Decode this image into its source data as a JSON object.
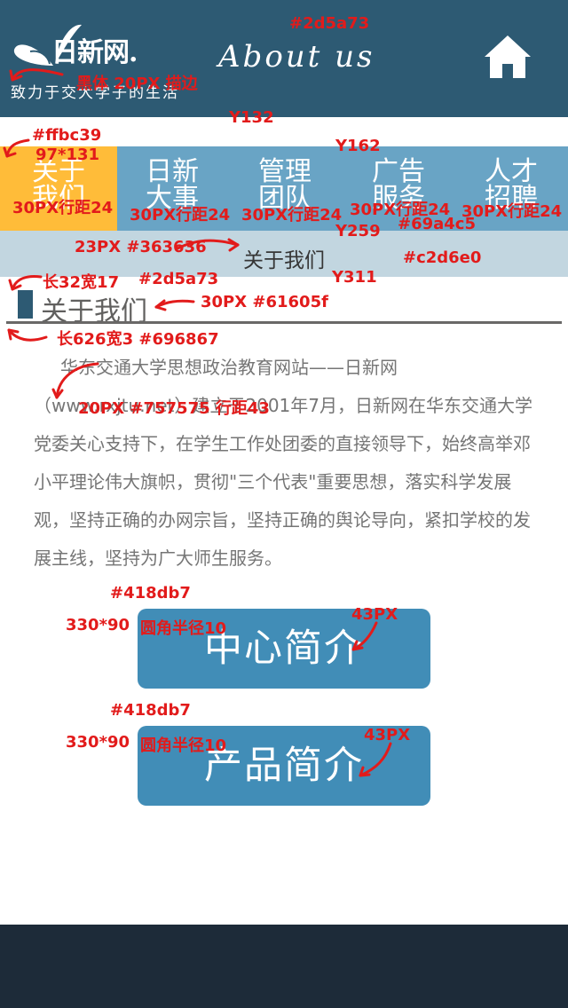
{
  "header": {
    "logo_text": "日新网.",
    "slogan": "致力于交大学子的生活",
    "page_title": "About us",
    "bg_color": "#2d5a73"
  },
  "nav": {
    "items": [
      {
        "label": "关于我们",
        "active": true
      },
      {
        "label": "日新大事",
        "active": false
      },
      {
        "label": "管理团队",
        "active": false
      },
      {
        "label": "广告服务",
        "active": false
      },
      {
        "label": "人才招聘",
        "active": false
      }
    ],
    "bg_color": "#69a4c5",
    "active_color": "#ffbc39"
  },
  "subbar": {
    "label": "关于我们",
    "bg_color": "#c2d6e0"
  },
  "section": {
    "title": "关于我们"
  },
  "content": {
    "text": "华东交通大学思想政治教育网站——日新网（www.rxjtu.net）建立于2001年7月，日新网在华东交通大学党委关心支持下，在学生工作处团委的直接领导下，始终高举邓小平理论伟大旗帜，贯彻\"三个代表\"重要思想，落实科学发展观，坚持正确的办网宗旨，坚持正确的舆论导向，紧扣学校的发展主线，坚持为广大师生服务。"
  },
  "buttons": {
    "center_intro": "中心简介",
    "product_intro": "产品简介",
    "color": "#418db7"
  },
  "annotations": {
    "header_color": "#2d5a73",
    "slogan_spec": "黑体 20PX 描边",
    "y132": "Y132",
    "nav_active_color": "#ffbc39",
    "nav_active_size": "97*131",
    "y162": "Y162",
    "nav_font_1": "30PX行距24",
    "nav_font_2": "30PX行距24",
    "nav_font_3": "30PX行距24",
    "nav_font_4": "30PX行距24",
    "nav_font_5": "30PX行距24",
    "y259": "Y259",
    "nav_color": "#69a4c5",
    "subbar_font": "23PX #363636",
    "subbar_color": "#c2d6e0",
    "marker_size": "长32宽17",
    "marker_color": "#2d5a73",
    "y311": "Y311",
    "title_font": "30PX  #61605f",
    "rule_spec": "长626宽3  #696867",
    "content_font": "20PX  #757575  行距43",
    "btn1_color": "#418db7",
    "btn1_size": "330*90",
    "btn1_radius": "圆角半径10",
    "btn1_font": "43PX",
    "btn2_color": "#418db7",
    "btn2_size": "330*90",
    "btn2_radius": "圆角半径10",
    "btn2_font": "43PX"
  }
}
